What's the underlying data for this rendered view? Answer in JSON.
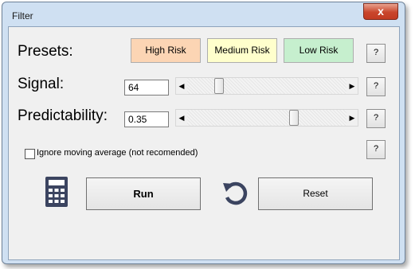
{
  "window": {
    "title": "Filter",
    "close_glyph": "x"
  },
  "presets": {
    "label": "Presets:",
    "buttons": [
      {
        "label": "High Risk",
        "color": "#fcd5b4"
      },
      {
        "label": "Medium Risk",
        "color": "#ffffcc"
      },
      {
        "label": "Low Risk",
        "color": "#c6efce"
      }
    ]
  },
  "signal": {
    "label": "Signal:",
    "value": "64",
    "slider_fraction": 0.18
  },
  "predictability": {
    "label": "Predictability:",
    "value": "0.35",
    "slider_fraction": 0.68
  },
  "help_label": "?",
  "ignore_ma": {
    "label": "Ignore moving average (not recomended)",
    "checked": false
  },
  "actions": {
    "run_label": "Run",
    "reset_label": "Reset",
    "calculator_icon": "calculator-icon",
    "reset_icon": "reset-icon"
  },
  "arrows": {
    "left": "◀",
    "right": "▶"
  }
}
